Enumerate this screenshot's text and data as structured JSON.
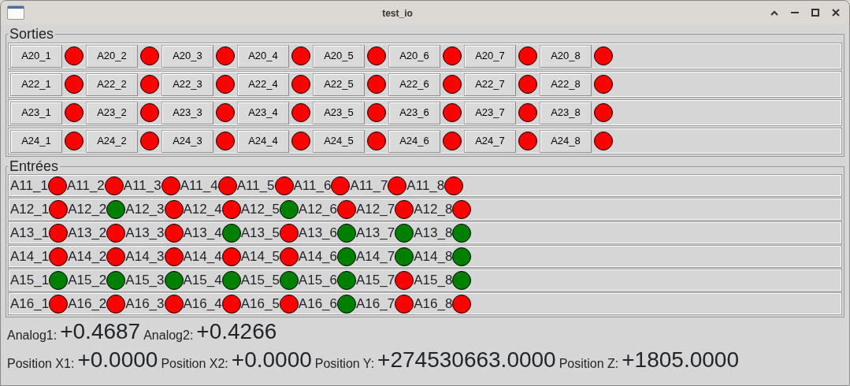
{
  "window": {
    "title": "test_io"
  },
  "outputs": {
    "title": "Sorties",
    "rows": [
      {
        "items": [
          {
            "label": "A20_1",
            "on": false
          },
          {
            "label": "A20_2",
            "on": false
          },
          {
            "label": "A20_3",
            "on": false
          },
          {
            "label": "A20_4",
            "on": false
          },
          {
            "label": "A20_5",
            "on": false
          },
          {
            "label": "A20_6",
            "on": false
          },
          {
            "label": "A20_7",
            "on": false
          },
          {
            "label": "A20_8",
            "on": false
          }
        ]
      },
      {
        "items": [
          {
            "label": "A22_1",
            "on": false
          },
          {
            "label": "A22_2",
            "on": false
          },
          {
            "label": "A22_3",
            "on": false
          },
          {
            "label": "A22_4",
            "on": false
          },
          {
            "label": "A22_5",
            "on": false
          },
          {
            "label": "A22_6",
            "on": false
          },
          {
            "label": "A22_7",
            "on": false
          },
          {
            "label": "A22_8",
            "on": false
          }
        ]
      },
      {
        "items": [
          {
            "label": "A23_1",
            "on": false
          },
          {
            "label": "A23_2",
            "on": false
          },
          {
            "label": "A23_3",
            "on": false
          },
          {
            "label": "A23_4",
            "on": false
          },
          {
            "label": "A23_5",
            "on": false
          },
          {
            "label": "A23_6",
            "on": false
          },
          {
            "label": "A23_7",
            "on": false
          },
          {
            "label": "A23_8",
            "on": false
          }
        ]
      },
      {
        "items": [
          {
            "label": "A24_1",
            "on": false
          },
          {
            "label": "A24_2",
            "on": false
          },
          {
            "label": "A24_3",
            "on": false
          },
          {
            "label": "A24_4",
            "on": false
          },
          {
            "label": "A24_5",
            "on": false
          },
          {
            "label": "A24_6",
            "on": false
          },
          {
            "label": "A24_7",
            "on": false
          },
          {
            "label": "A24_8",
            "on": false
          }
        ]
      }
    ]
  },
  "inputs": {
    "title": "Entrées",
    "rows": [
      {
        "items": [
          {
            "label": "A11_1",
            "on": false
          },
          {
            "label": "A11_2",
            "on": false
          },
          {
            "label": "A11_3",
            "on": false
          },
          {
            "label": "A11_4",
            "on": false
          },
          {
            "label": "A11_5",
            "on": false
          },
          {
            "label": "A11_6",
            "on": false
          },
          {
            "label": "A11_7",
            "on": false
          },
          {
            "label": "A11_8",
            "on": false
          }
        ]
      },
      {
        "items": [
          {
            "label": "A12_1",
            "on": false
          },
          {
            "label": "A12_2",
            "on": true
          },
          {
            "label": "A12_3",
            "on": false
          },
          {
            "label": "A12_4",
            "on": false
          },
          {
            "label": "A12_5",
            "on": true
          },
          {
            "label": "A12_6",
            "on": false
          },
          {
            "label": "A12_7",
            "on": false
          },
          {
            "label": "A12_8",
            "on": false
          }
        ]
      },
      {
        "items": [
          {
            "label": "A13_1",
            "on": false
          },
          {
            "label": "A13_2",
            "on": false
          },
          {
            "label": "A13_3",
            "on": false
          },
          {
            "label": "A13_4",
            "on": true
          },
          {
            "label": "A13_5",
            "on": false
          },
          {
            "label": "A13_6",
            "on": true
          },
          {
            "label": "A13_7",
            "on": true
          },
          {
            "label": "A13_8",
            "on": true
          }
        ]
      },
      {
        "items": [
          {
            "label": "A14_1",
            "on": false
          },
          {
            "label": "A14_2",
            "on": false
          },
          {
            "label": "A14_3",
            "on": false
          },
          {
            "label": "A14_4",
            "on": false
          },
          {
            "label": "A14_5",
            "on": false
          },
          {
            "label": "A14_6",
            "on": true
          },
          {
            "label": "A14_7",
            "on": true
          },
          {
            "label": "A14_8",
            "on": true
          }
        ]
      },
      {
        "items": [
          {
            "label": "A15_1",
            "on": true
          },
          {
            "label": "A15_2",
            "on": true
          },
          {
            "label": "A15_3",
            "on": true
          },
          {
            "label": "A15_4",
            "on": true
          },
          {
            "label": "A15_5",
            "on": true
          },
          {
            "label": "A15_6",
            "on": true
          },
          {
            "label": "A15_7",
            "on": false
          },
          {
            "label": "A15_8",
            "on": true
          }
        ]
      },
      {
        "items": [
          {
            "label": "A16_1",
            "on": false
          },
          {
            "label": "A16_2",
            "on": false
          },
          {
            "label": "A16_3",
            "on": false
          },
          {
            "label": "A16_4",
            "on": false
          },
          {
            "label": "A16_5",
            "on": false
          },
          {
            "label": "A16_6",
            "on": true
          },
          {
            "label": "A16_7",
            "on": false
          },
          {
            "label": "A16_8",
            "on": false
          }
        ]
      }
    ]
  },
  "readouts": [
    [
      {
        "label": "Analog1:",
        "value": "+0.4687"
      },
      {
        "label": "Analog2:",
        "value": "+0.4266"
      }
    ],
    [
      {
        "label": "Position X1:",
        "value": "+0.0000"
      },
      {
        "label": "Position X2:",
        "value": "+0.0000"
      },
      {
        "label": "Position Y:",
        "value": "+274530663.0000"
      },
      {
        "label": "Position Z:",
        "value": "+1805.0000"
      }
    ]
  ]
}
